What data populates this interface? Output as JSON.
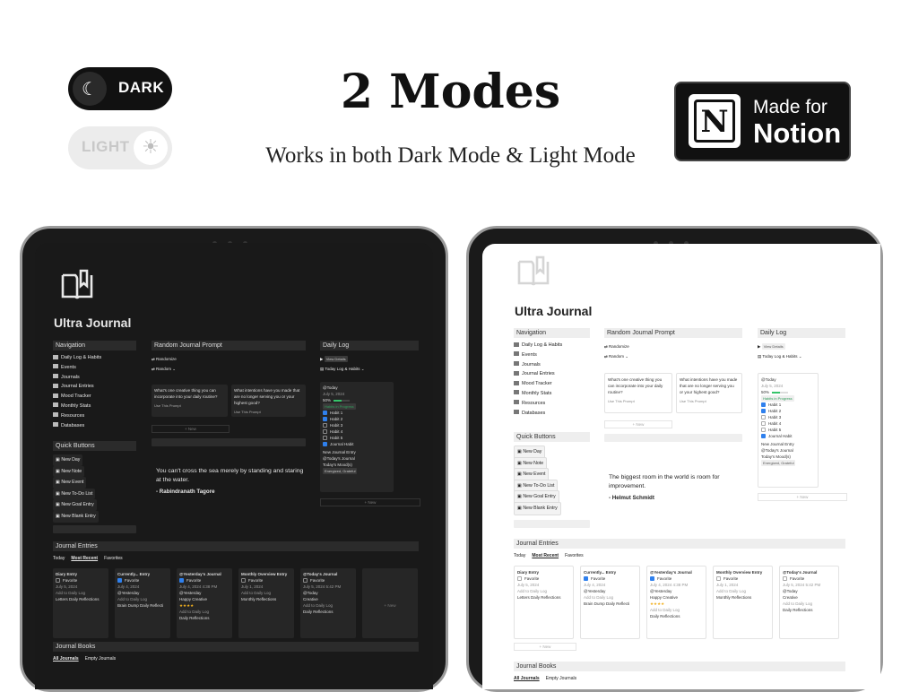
{
  "header": {
    "title": "2 Modes",
    "subtitle": "Works in both Dark Mode & Light Mode"
  },
  "toggles": {
    "dark_label": "DARK",
    "light_label": "LIGHT",
    "dark_icon": "moon-stars-icon",
    "light_icon": "sun-icon"
  },
  "badge": {
    "line1": "Made for",
    "line2": "Notion",
    "logo_letter": "N"
  },
  "colors": {
    "dark_bg": "#191919",
    "light_bg": "#ffffff",
    "accent_blue": "#2f80ed",
    "progress_green": "#35c46a",
    "star_gold": "#f2b01e"
  },
  "notion": {
    "app_title": "Ultra Journal",
    "navigation": {
      "heading": "Navigation",
      "items": [
        "Daily Log & Habits",
        "Events",
        "Journals",
        "Journal Entries",
        "Mood Tracker",
        "Monthly Stats",
        "Resources",
        "Databases"
      ]
    },
    "quick_buttons": {
      "heading": "Quick Buttons",
      "items": [
        "New Day",
        "New Note",
        "New Event",
        "New To-Do List",
        "New Goal Entry",
        "New Blank Entry"
      ]
    },
    "prompt": {
      "heading": "Random Journal Prompt",
      "randomize": "Randomize",
      "random": "Random",
      "cards": [
        {
          "text": "What's one creative thing you can incorporate into your daily routine?",
          "link": "Use This Prompt"
        },
        {
          "text": "What intentions have you made that are no longer serving you or your highest good?",
          "link": "Use This Prompt"
        }
      ],
      "new": "+ New"
    },
    "dark_quote": {
      "text": "You can't cross the sea merely by standing and staring at the water.",
      "author": "- Rabindranath Tagore"
    },
    "light_quote": {
      "text": "The biggest room in the world is room for improvement.",
      "author": "- Helmut Schmidt"
    },
    "daily_log": {
      "heading": "Daily Log",
      "view_details": "View Details",
      "today_log": "Today Log & Habits",
      "card_title": "@Today",
      "date": "July 5, 2024",
      "percent": "50%",
      "status": "Habits in Progress",
      "habits": [
        "Habit 1",
        "Habit 2",
        "Habit 3",
        "Habit 4",
        "Habit 5",
        "Journal Habit"
      ],
      "habits_checked": [
        true,
        true,
        false,
        false,
        false,
        true
      ],
      "new_entry": "New Journal Entry",
      "journal_link": "@Today's Journal",
      "moods_label": "Today's Mood(s)",
      "moods": "Energized, Grateful",
      "new": "+ New"
    },
    "journal_entries": {
      "heading": "Journal Entries",
      "tabs": [
        "Today",
        "Most Recent",
        "Favorites"
      ],
      "cards": [
        {
          "title": "Diary Entry",
          "favorite": "Favorite",
          "date": "July 5, 2024",
          "add": "Add to Daily Log",
          "tags": "Letters  Daily Reflections"
        },
        {
          "title": "Currently... Entry",
          "favorite": "Favorite",
          "date": "July 4, 2024",
          "extra": "@Yesterday",
          "add": "Add to Daily Log",
          "tags": "Brain Dump  Daily Reflecti"
        },
        {
          "title": "@Yesterday's Journal",
          "favorite": "Favorite",
          "date": "July 4, 2024 4:38 PM",
          "extra": "@Yesterday",
          "mood": "Happy  Creative",
          "stars": "★★★★",
          "add": "Add to Daily Log",
          "tags": "Daily Reflections"
        },
        {
          "title": "Monthly Overview Entry",
          "favorite": "Favorite",
          "date": "July 1, 2024",
          "add": "Add to Daily Log",
          "tags": "Monthly Reflections"
        },
        {
          "title": "@Today's Journal",
          "favorite": "Favorite",
          "date": "July 5, 2024 5:42 PM",
          "extra": "@Today",
          "mood": "Creative",
          "add": "Add to Daily Log",
          "tags": "Daily Reflections"
        }
      ],
      "new": "+ New"
    },
    "journal_books": {
      "heading": "Journal Books",
      "tabs": [
        "All Journals",
        "Empty Journals"
      ]
    }
  }
}
